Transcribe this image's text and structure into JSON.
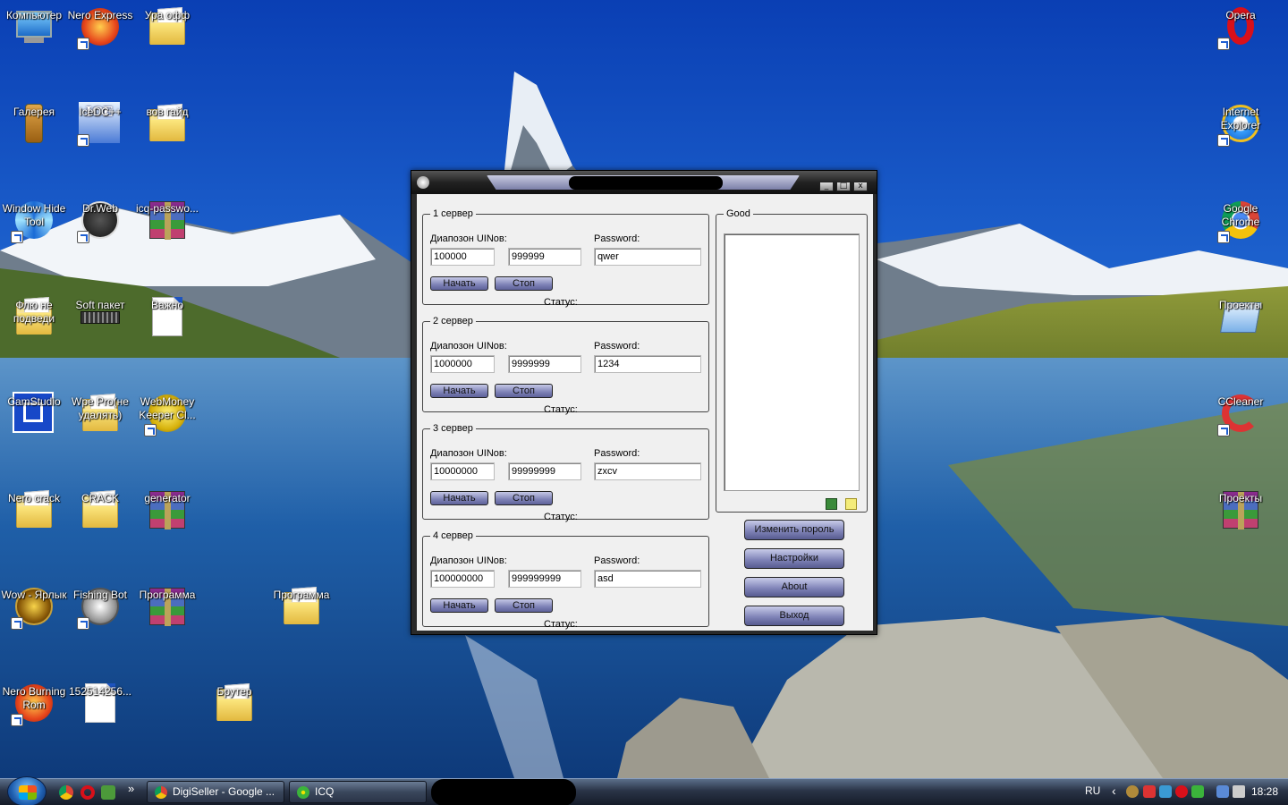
{
  "desktop": {
    "icons": [
      {
        "label": "Компьютер",
        "icon": "computer-icon"
      },
      {
        "label": "Nero Express",
        "icon": "nero-icon"
      },
      {
        "label": "Ура офф",
        "icon": "folder-icon"
      },
      {
        "label": "Галерея",
        "icon": "phone-icon"
      },
      {
        "label": "IceDC++",
        "icon": "icedc-icon"
      },
      {
        "label": "вов гайд",
        "icon": "folder-icon"
      },
      {
        "label": "Window Hide Tool",
        "icon": "window-hide-icon"
      },
      {
        "label": "Dr.Web",
        "icon": "drweb-icon"
      },
      {
        "label": "icq-passwo...",
        "icon": "winrar-icon"
      },
      {
        "label": "Флю не подведи",
        "icon": "folder-icon"
      },
      {
        "label": "Soft пакет",
        "icon": "folder-icon"
      },
      {
        "label": "Важно",
        "icon": "text-file-icon"
      },
      {
        "label": "CamStudio",
        "icon": "camstudio-icon"
      },
      {
        "label": "Wpe Pro(не удалять)",
        "icon": "folder-icon"
      },
      {
        "label": "WebMoney Keeper Cl...",
        "icon": "webmoney-icon"
      },
      {
        "label": "Nero crack",
        "icon": "folder-icon"
      },
      {
        "label": "CRACK",
        "icon": "folder-icon"
      },
      {
        "label": "generator",
        "icon": "winrar-icon"
      },
      {
        "label": "Wow - Ярлык",
        "icon": "wow-icon"
      },
      {
        "label": "Fishing Bot",
        "icon": "fishing-bot-icon"
      },
      {
        "label": "Программа",
        "icon": "winrar-icon"
      },
      {
        "label": "Программа",
        "icon": "folder-icon"
      },
      {
        "label": "Nero Burning Rom",
        "icon": "nero-icon"
      },
      {
        "label": "152514256...",
        "icon": "file-icon"
      },
      {
        "label": "Брутер",
        "icon": "folder-icon"
      },
      {
        "label": "Opera",
        "icon": "opera-icon"
      },
      {
        "label": "Internet Explorer",
        "icon": "ie-icon"
      },
      {
        "label": "Google Chrome",
        "icon": "chrome-icon"
      },
      {
        "label": "Проекты",
        "icon": "projects-icon"
      },
      {
        "label": "CCleaner",
        "icon": "ccleaner-icon"
      },
      {
        "label": "Проекты",
        "icon": "winrar-icon"
      }
    ]
  },
  "app": {
    "servers": [
      {
        "title": "1 сервер",
        "range_label": "Диапозон UINов:",
        "from": "100000",
        "to": "999999",
        "password_label": "Password:",
        "password": "qwer",
        "start": "Начать",
        "stop": "Стоп",
        "status_label": "Статус:"
      },
      {
        "title": "2 сервер",
        "range_label": "Диапозон UINов:",
        "from": "1000000",
        "to": "9999999",
        "password_label": "Password:",
        "password": "1234",
        "start": "Начать",
        "stop": "Стоп",
        "status_label": "Статус:"
      },
      {
        "title": "3 сервер",
        "range_label": "Диапозон UINов:",
        "from": "10000000",
        "to": "99999999",
        "password_label": "Password:",
        "password": "zxcv",
        "start": "Начать",
        "stop": "Стоп",
        "status_label": "Статус:"
      },
      {
        "title": "4 сервер",
        "range_label": "Диапозон UINов:",
        "from": "100000000",
        "to": "999999999",
        "password_label": "Password:",
        "password": "asd",
        "start": "Начать",
        "stop": "Стоп",
        "status_label": "Статус:"
      }
    ],
    "good_title": "Good",
    "buttons": {
      "change_password": "Изменить пороль",
      "settings": "Настройки",
      "about": "About",
      "exit": "Выход"
    },
    "window_controls": {
      "minimize": "_",
      "maximize": "□",
      "close": "x"
    }
  },
  "taskbar": {
    "tasks": [
      {
        "label": "DigiSeller - Google ...",
        "icon": "chrome-icon"
      },
      {
        "label": "ICQ",
        "icon": "icq-icon"
      }
    ],
    "overflow": "»",
    "language": "RU",
    "tray_arrow": "‹",
    "clock": "18:28"
  },
  "colors": {
    "button_accent": "#7d81b6",
    "window_frame": "#2a2a2a",
    "taskbar": "#2a3447"
  }
}
